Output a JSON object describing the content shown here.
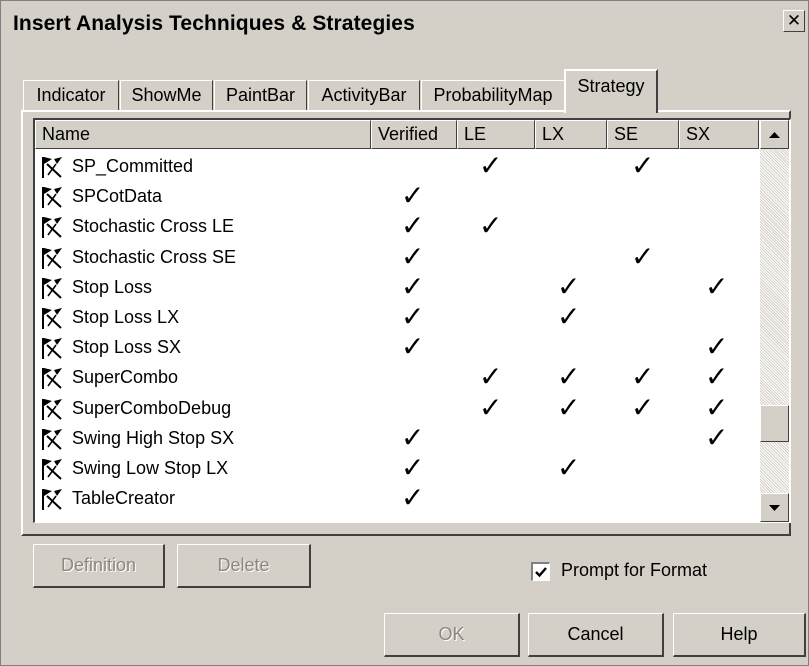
{
  "window": {
    "title": "Insert Analysis Techniques & Strategies",
    "close_glyph": "✕"
  },
  "tabs": [
    {
      "label": "Indicator"
    },
    {
      "label": "ShowMe"
    },
    {
      "label": "PaintBar"
    },
    {
      "label": "ActivityBar"
    },
    {
      "label": "ProbabilityMap"
    },
    {
      "label": "Strategy",
      "active": true
    }
  ],
  "list": {
    "columns": [
      "Name",
      "Verified",
      "LE",
      "LX",
      "SE",
      "SX"
    ],
    "check_glyph": "✓",
    "icon": "strategy-flag-icon",
    "rows": [
      {
        "name": "SP_Committed",
        "verified": false,
        "le": true,
        "lx": false,
        "se": true,
        "sx": false
      },
      {
        "name": "SPCotData",
        "verified": true,
        "le": false,
        "lx": false,
        "se": false,
        "sx": false
      },
      {
        "name": "Stochastic Cross LE",
        "verified": true,
        "le": true,
        "lx": false,
        "se": false,
        "sx": false
      },
      {
        "name": "Stochastic Cross SE",
        "verified": true,
        "le": false,
        "lx": false,
        "se": true,
        "sx": false
      },
      {
        "name": "Stop Loss",
        "verified": true,
        "le": false,
        "lx": true,
        "se": false,
        "sx": true
      },
      {
        "name": "Stop Loss LX",
        "verified": true,
        "le": false,
        "lx": true,
        "se": false,
        "sx": false
      },
      {
        "name": "Stop Loss SX",
        "verified": true,
        "le": false,
        "lx": false,
        "se": false,
        "sx": true
      },
      {
        "name": "SuperCombo",
        "verified": false,
        "le": true,
        "lx": true,
        "se": true,
        "sx": true
      },
      {
        "name": "SuperComboDebug",
        "verified": false,
        "le": true,
        "lx": true,
        "se": true,
        "sx": true
      },
      {
        "name": "Swing High Stop SX",
        "verified": true,
        "le": false,
        "lx": false,
        "se": false,
        "sx": true
      },
      {
        "name": "Swing Low Stop LX",
        "verified": true,
        "le": false,
        "lx": true,
        "se": false,
        "sx": false
      },
      {
        "name": "TableCreator",
        "verified": true,
        "le": false,
        "lx": false,
        "se": false,
        "sx": false
      }
    ]
  },
  "buttons": {
    "definition": {
      "label": "Definition",
      "enabled": false
    },
    "delete": {
      "label": "Delete",
      "enabled": false
    },
    "ok": {
      "label": "OK",
      "enabled": false
    },
    "cancel": {
      "label": "Cancel"
    },
    "help": {
      "label": "Help"
    }
  },
  "prompt_for_format": {
    "label": "Prompt for Format",
    "checked": true
  }
}
